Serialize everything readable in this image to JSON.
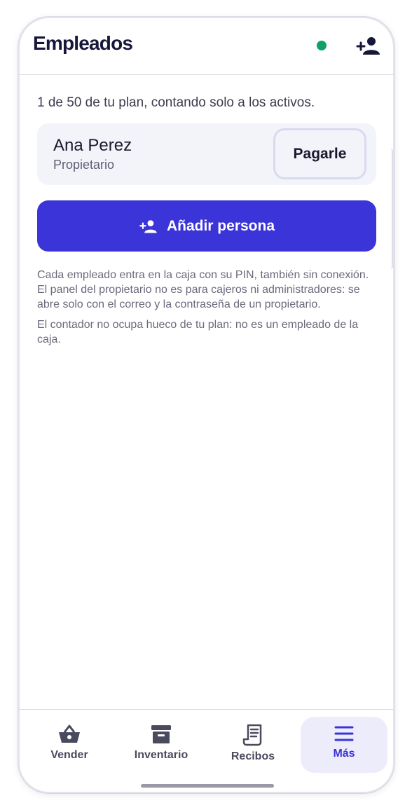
{
  "header": {
    "title": "Empleados",
    "status_color": "#12a06a",
    "add_user_icon": "person-add-icon"
  },
  "plan_text": "1 de 50 de tu plan, contando solo a los activos.",
  "owner": {
    "name": "Ana Perez",
    "role": "Propietario",
    "pay_label": "Pagarle"
  },
  "add_person": {
    "label": "Añadir persona",
    "icon": "person-add-icon"
  },
  "info": [
    "Cada empleado entra en la caja con su PIN, también sin conexión. El panel del propietario no es para cajeros ni administradores: se abre solo con el correo y la contraseña de un propietario.",
    "El contador no ocupa hueco de tu plan: no es un empleado de la caja."
  ],
  "nav": [
    {
      "label": "Vender",
      "icon": "basket-icon",
      "active": false
    },
    {
      "label": "Inventario",
      "icon": "archive-box-icon",
      "active": false
    },
    {
      "label": "Recibos",
      "icon": "receipt-icon",
      "active": false
    },
    {
      "label": "Más",
      "icon": "menu-icon",
      "active": true
    }
  ],
  "colors": {
    "accent": "#3b34d9",
    "title": "#17173a",
    "nav_active_bg": "#ececfb"
  }
}
